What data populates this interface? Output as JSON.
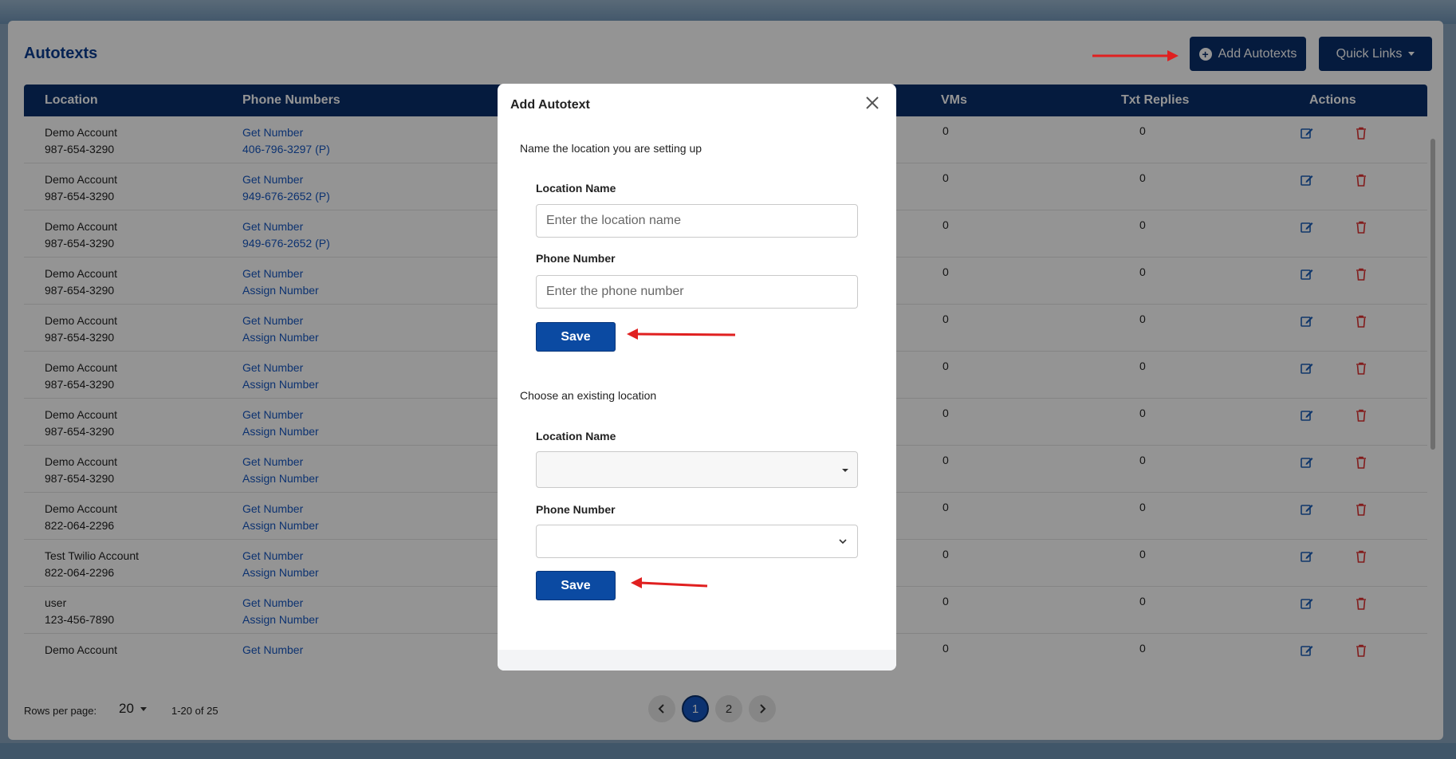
{
  "page": {
    "title": "Autotexts",
    "add_button": "Add Autotexts",
    "quick_links": "Quick Links"
  },
  "table": {
    "headers": [
      "Location",
      "Phone Numbers",
      "VMs",
      "Txt Replies",
      "Actions"
    ],
    "rows": [
      {
        "loc1": "Demo Account",
        "loc2": "987-654-3290",
        "ph1": "Get Number",
        "ph2": "406-796-3297 (P)",
        "vms": "0",
        "txt": "0"
      },
      {
        "loc1": "Demo Account",
        "loc2": "987-654-3290",
        "ph1": "Get Number",
        "ph2": "949-676-2652 (P)",
        "vms": "0",
        "txt": "0"
      },
      {
        "loc1": "Demo Account",
        "loc2": "987-654-3290",
        "ph1": "Get Number",
        "ph2": "949-676-2652 (P)",
        "vms": "0",
        "txt": "0"
      },
      {
        "loc1": "Demo Account",
        "loc2": "987-654-3290",
        "ph1": "Get Number",
        "ph2": "Assign Number",
        "vms": "0",
        "txt": "0"
      },
      {
        "loc1": "Demo Account",
        "loc2": "987-654-3290",
        "ph1": "Get Number",
        "ph2": "Assign Number",
        "vms": "0",
        "txt": "0"
      },
      {
        "loc1": "Demo Account",
        "loc2": "987-654-3290",
        "ph1": "Get Number",
        "ph2": "Assign Number",
        "vms": "0",
        "txt": "0"
      },
      {
        "loc1": "Demo Account",
        "loc2": "987-654-3290",
        "ph1": "Get Number",
        "ph2": "Assign Number",
        "vms": "0",
        "txt": "0"
      },
      {
        "loc1": "Demo Account",
        "loc2": "987-654-3290",
        "ph1": "Get Number",
        "ph2": "Assign Number",
        "vms": "0",
        "txt": "0"
      },
      {
        "loc1": "Demo Account",
        "loc2": "822-064-2296",
        "ph1": "Get Number",
        "ph2": "Assign Number",
        "vms": "0",
        "txt": "0"
      },
      {
        "loc1": "Test Twilio Account",
        "loc2": "822-064-2296",
        "ph1": "Get Number",
        "ph2": "Assign Number",
        "vms": "0",
        "txt": "0"
      },
      {
        "loc1": "user",
        "loc2": "123-456-7890",
        "ph1": "Get Number",
        "ph2": "Assign Number",
        "vms": "0",
        "txt": "0"
      },
      {
        "loc1": "Demo Account",
        "loc2": "",
        "ph1": "Get Number",
        "ph2": "",
        "vms": "0",
        "txt": "0"
      }
    ]
  },
  "footer": {
    "rows_per_page_label": "Rows per page:",
    "rows_per_page_value": "20",
    "range": "1-20 of 25",
    "pages": [
      "1",
      "2"
    ]
  },
  "modal": {
    "title": "Add Autotext",
    "section1": "Name the location you are setting up",
    "location_label": "Location Name",
    "location_placeholder": "Enter the location name",
    "phone_label": "Phone Number",
    "phone_placeholder": "Enter the phone number",
    "save": "Save",
    "section2": "Choose an existing location",
    "location_label2": "Location Name",
    "phone_label2": "Phone Number",
    "save2": "Save"
  },
  "colors": {
    "header_bg": "#0a2f6b",
    "link": "#1556c2",
    "annotation_arrow": "#e02020"
  }
}
